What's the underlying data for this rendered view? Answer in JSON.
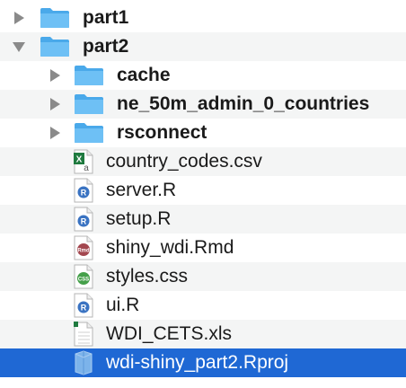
{
  "items": [
    {
      "label": "part1",
      "icon": "folder-icon",
      "expanded": false,
      "level": 0
    },
    {
      "label": "part2",
      "icon": "folder-icon",
      "expanded": true,
      "level": 0
    },
    {
      "label": "cache",
      "icon": "folder-icon",
      "expanded": false,
      "level": 1
    },
    {
      "label": "ne_50m_admin_0_countries",
      "icon": "folder-icon",
      "expanded": false,
      "level": 1
    },
    {
      "label": "rsconnect",
      "icon": "folder-icon",
      "expanded": false,
      "level": 1
    },
    {
      "label": "country_codes.csv",
      "icon": "csv-file-icon",
      "level": 1
    },
    {
      "label": "server.R",
      "icon": "r-file-icon",
      "level": 1
    },
    {
      "label": "setup.R",
      "icon": "r-file-icon",
      "level": 1
    },
    {
      "label": "shiny_wdi.Rmd",
      "icon": "rmd-file-icon",
      "level": 1
    },
    {
      "label": "styles.css",
      "icon": "css-file-icon",
      "level": 1
    },
    {
      "label": "ui.R",
      "icon": "r-file-icon",
      "level": 1
    },
    {
      "label": "WDI_CETS.xls",
      "icon": "xls-file-icon",
      "level": 1
    },
    {
      "label": "wdi-shiny_part2.Rproj",
      "icon": "rproj-file-icon",
      "level": 1,
      "selected": true
    }
  ],
  "colors": {
    "folder": "#5bb6f2",
    "selection": "#1f68d4",
    "alt_row": "#f4f5f5",
    "disclosure": "#8a8a8a"
  },
  "icon_labels": {
    "r": "R",
    "rmd": "Rmd",
    "css": "CSS",
    "excel": "X",
    "excel_sub": "a"
  }
}
